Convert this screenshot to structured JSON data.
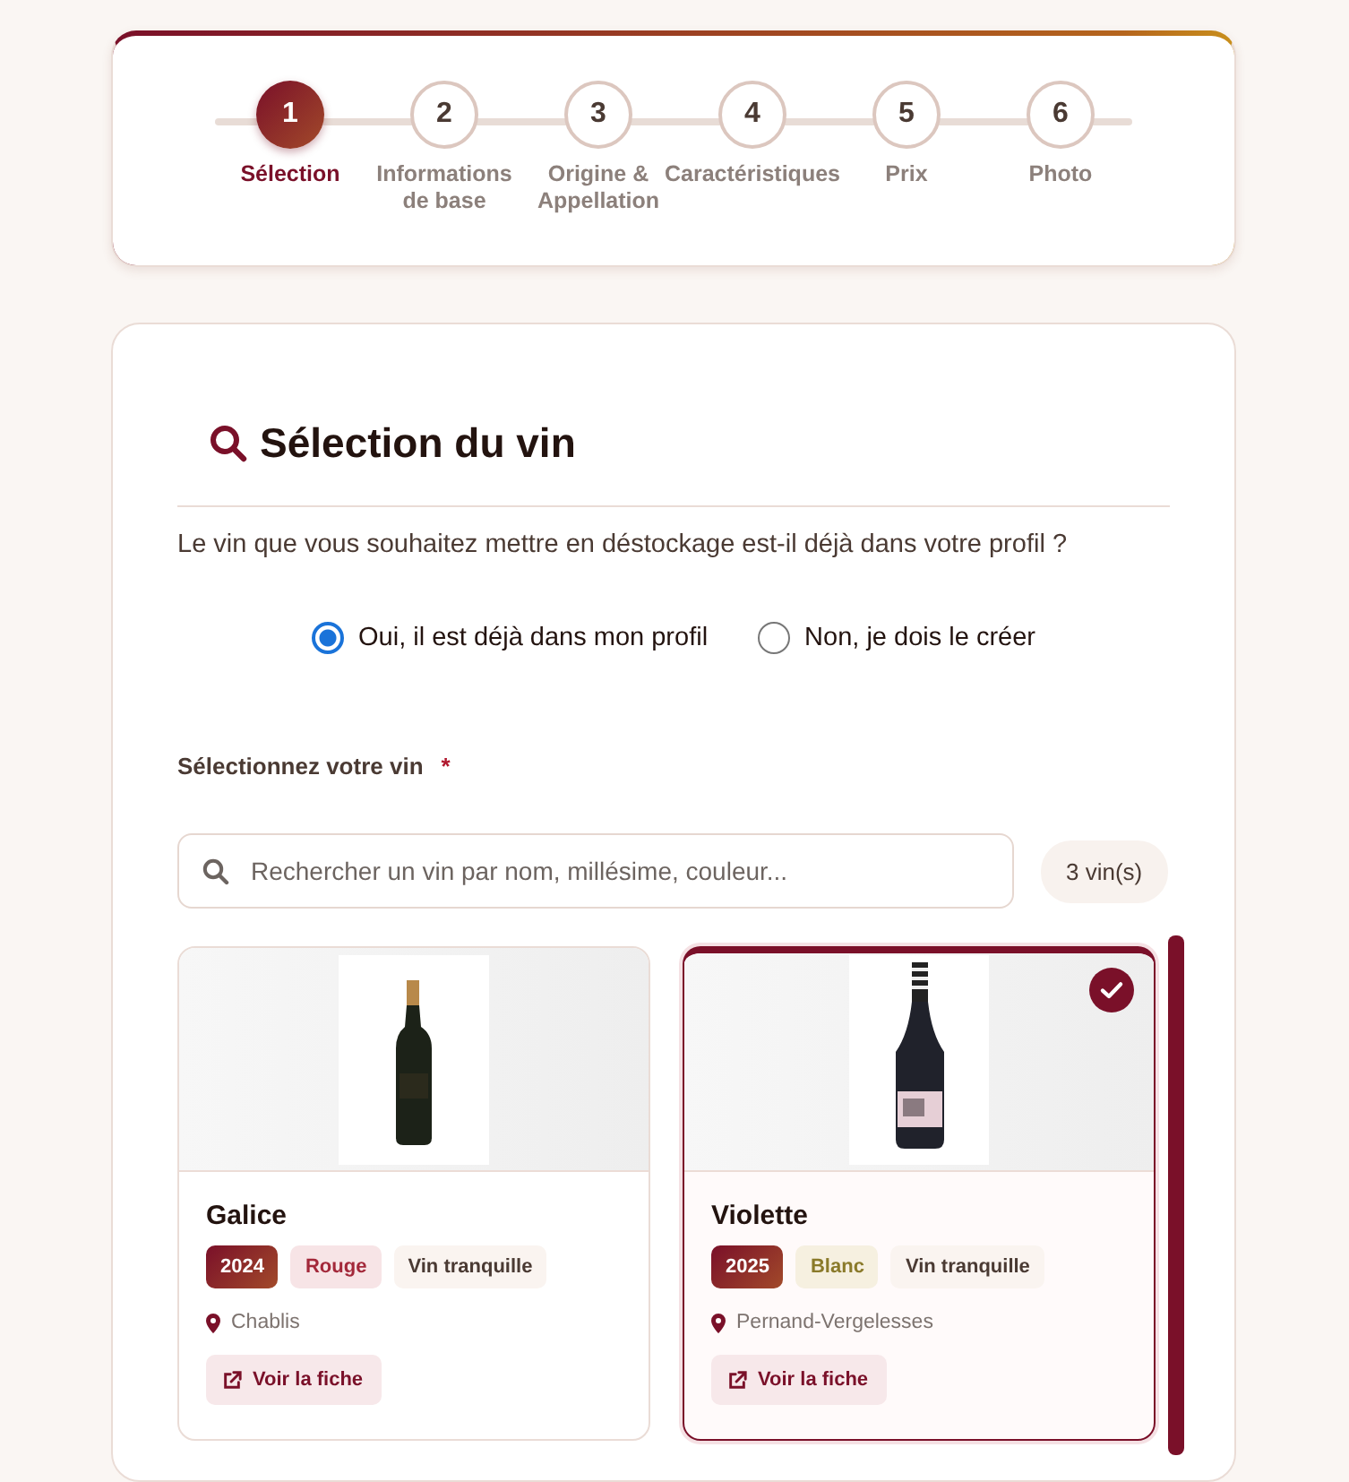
{
  "steps": [
    {
      "number": "1",
      "label": "Sélection",
      "selected": true
    },
    {
      "number": "2",
      "label": "Informations de base",
      "selected": false
    },
    {
      "number": "3",
      "label": "Origine & Appellation",
      "selected": false
    },
    {
      "number": "4",
      "label": "Caractéristiques",
      "selected": false
    },
    {
      "number": "5",
      "label": "Prix",
      "selected": false
    },
    {
      "number": "6",
      "label": "Photo",
      "selected": false
    }
  ],
  "section": {
    "title": "Sélection du vin",
    "question": "Le vin que vous souhaitez mettre en déstockage est-il déjà dans votre profil ?",
    "options": [
      {
        "label": "Oui, il est déjà dans mon profil",
        "selected": true
      },
      {
        "label": "Non, je dois le créer",
        "selected": false
      }
    ],
    "field_label": "Sélectionnez votre vin",
    "required_mark": "*",
    "search": {
      "placeholder": "Rechercher un vin par nom, millésime, couleur..."
    },
    "count": "3 vin(s)"
  },
  "wines": [
    {
      "name": "Galice",
      "year": "2024",
      "color": {
        "label": "Rouge",
        "kind": "red"
      },
      "type": "Vin tranquille",
      "location": "Chablis",
      "link": "Voir la fiche",
      "selected": false
    },
    {
      "name": "Violette",
      "year": "2025",
      "color": {
        "label": "Blanc",
        "kind": "white"
      },
      "type": "Vin tranquille",
      "location": "Pernand-Vergelesses",
      "link": "Voir la fiche",
      "selected": true
    }
  ]
}
